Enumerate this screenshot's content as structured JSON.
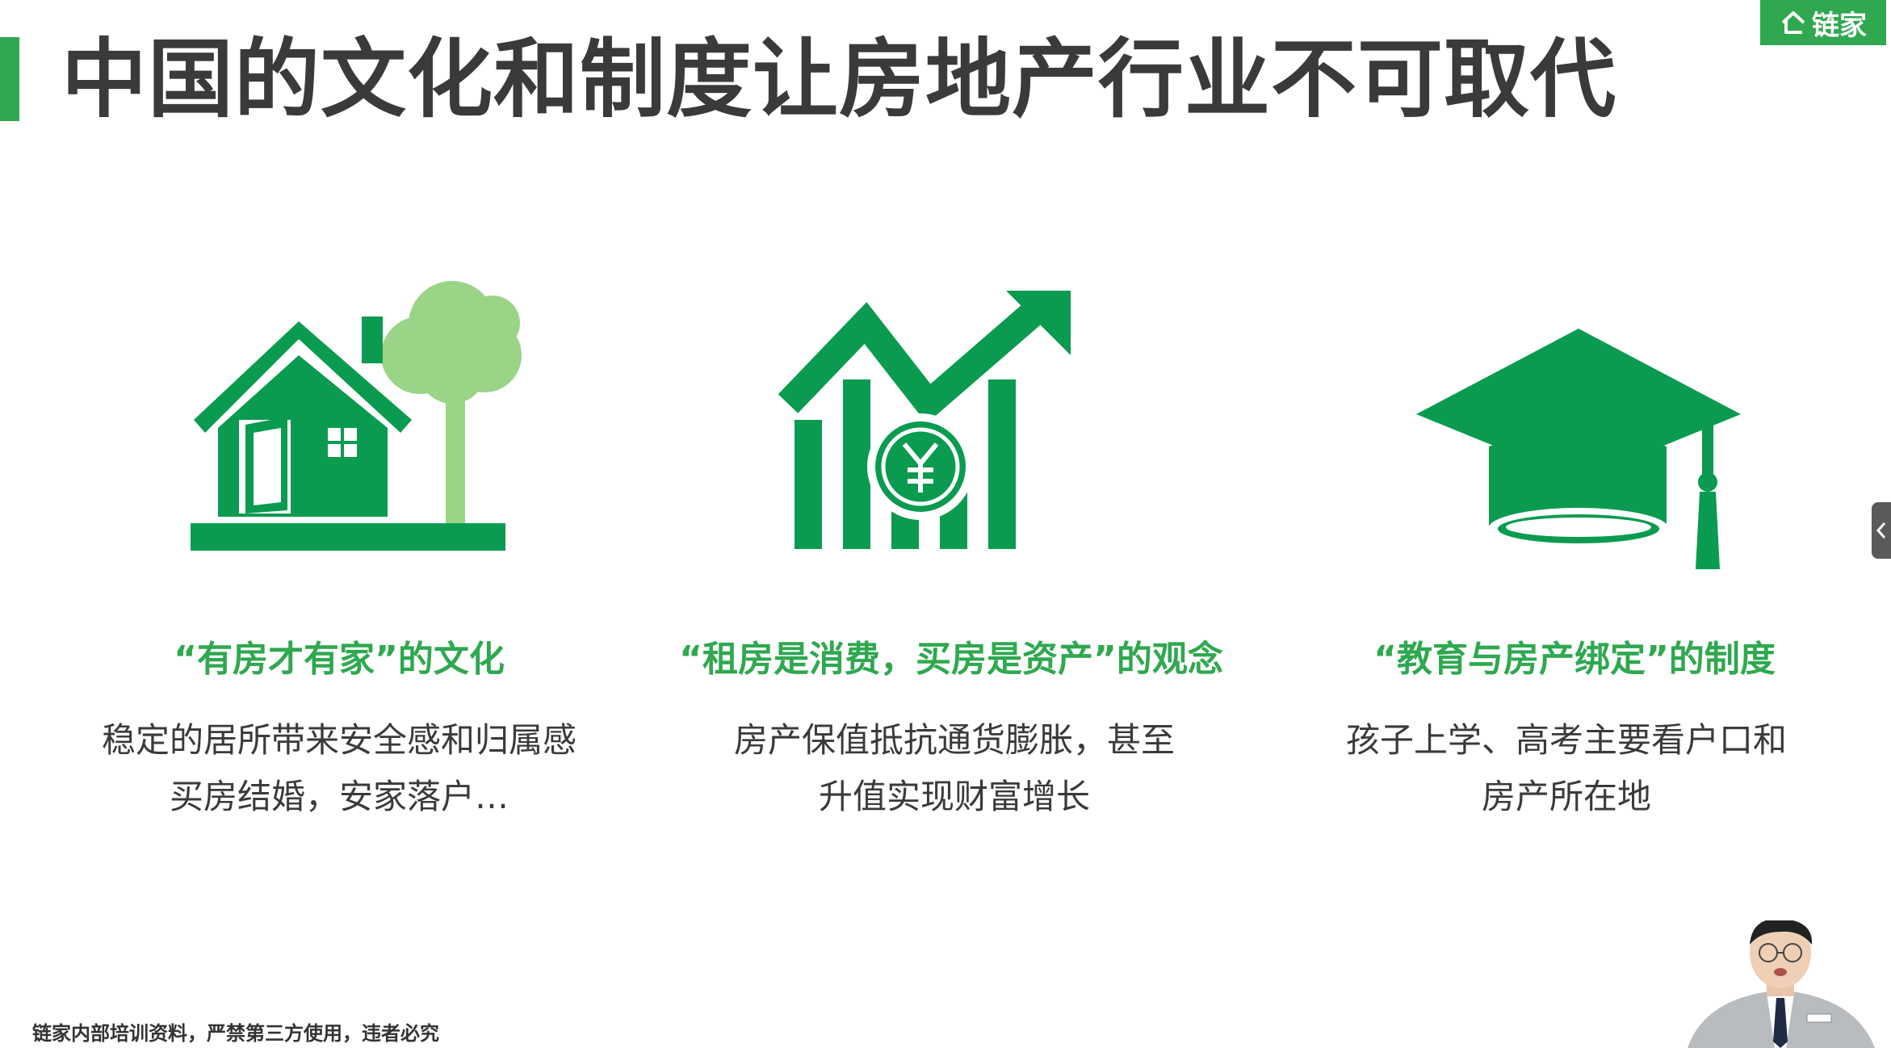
{
  "header": {
    "title": "中国的文化和制度让房地产行业不可取代",
    "brand": "链家"
  },
  "colors": {
    "accent": "#2fa84f",
    "dark_green": "#0a9b50",
    "light_green": "#9ad487",
    "text": "#3a3a3a"
  },
  "columns": [
    {
      "icon": "house-tree-icon",
      "heading": "“有房才有家”的文化",
      "lines": [
        "稳定的居所带来安全感和归属感",
        "买房结婚，安家落户…"
      ]
    },
    {
      "icon": "growth-chart-yuan-icon",
      "heading": "“租房是消费，买房是资产”的观念",
      "lines": [
        "房产保值抵抗通货膨胀，甚至",
        "升值实现财富增长"
      ]
    },
    {
      "icon": "graduation-cap-icon",
      "heading": "“教育与房产绑定”的制度",
      "lines": [
        "孩子上学、高考主要看户口和",
        "房产所在地"
      ]
    }
  ],
  "footer": {
    "note": "链家内部培训资料，严禁第三方使用，违者必究"
  },
  "widgets": {
    "side_handle_icon": "chevron-left-icon",
    "presenter": "presenter-video-thumbnail"
  }
}
